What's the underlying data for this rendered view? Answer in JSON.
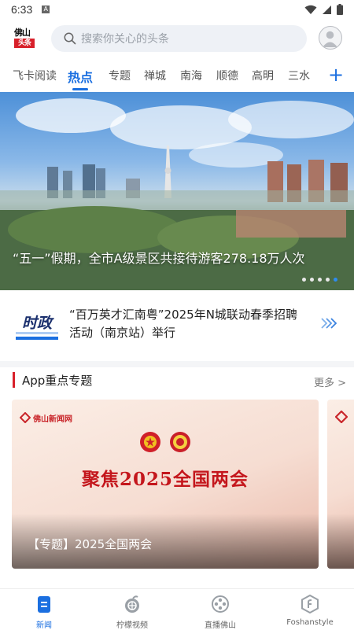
{
  "status_bar": {
    "time": "6:33",
    "notification_icon": "a-badge-icon",
    "signal": "wifi-icon",
    "battery": "battery-icon"
  },
  "header": {
    "logo_line1": "佛山",
    "logo_line2": "头条",
    "search_placeholder": "搜索你关心的头条"
  },
  "tabs": [
    {
      "label": "飞卡阅读"
    },
    {
      "label": "热点",
      "active": true
    },
    {
      "label": "专题"
    },
    {
      "label": "禅城"
    },
    {
      "label": "南海"
    },
    {
      "label": "顺德"
    },
    {
      "label": "高明"
    },
    {
      "label": "三水"
    }
  ],
  "banner": {
    "caption": "“五一”假期，全市A级景区共接待游客278.18万人次",
    "slide_count": 5,
    "active_slide": 5
  },
  "news": {
    "badge": "时政",
    "title": "“百万英才汇南粤”2025年N城联动春季招聘活动（南京站）举行"
  },
  "section": {
    "title": "App重点专题",
    "more": "更多 >"
  },
  "cards": [
    {
      "brand": "佛山新闻网",
      "headline": "聚焦2025全国两会",
      "caption": "【专题】2025全国两会"
    },
    {
      "caption": "【"
    }
  ],
  "bottom_nav": [
    {
      "label": "新闻",
      "active": true
    },
    {
      "label": "柠檬视频"
    },
    {
      "label": "直播佛山"
    },
    {
      "label": "Foshanstyle"
    }
  ],
  "colors": {
    "accent": "#1b6fe0",
    "brand_red": "#d8202a",
    "headline_red": "#c4161c"
  }
}
